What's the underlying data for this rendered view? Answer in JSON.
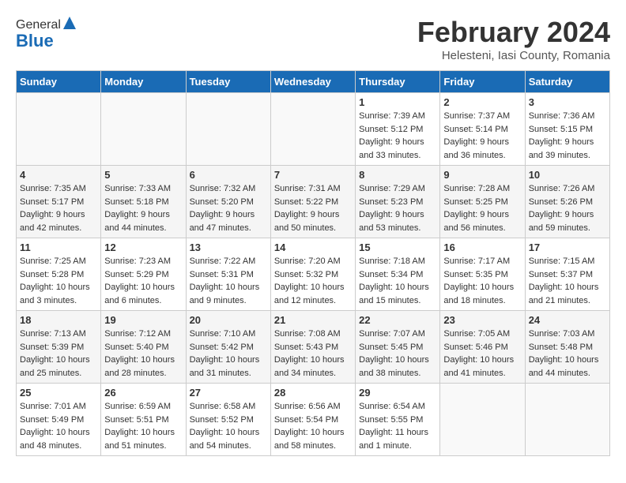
{
  "header": {
    "logo_general": "General",
    "logo_blue": "Blue",
    "month_year": "February 2024",
    "location": "Helesteni, Iasi County, Romania"
  },
  "weekdays": [
    "Sunday",
    "Monday",
    "Tuesday",
    "Wednesday",
    "Thursday",
    "Friday",
    "Saturday"
  ],
  "weeks": [
    [
      {
        "day": "",
        "empty": true
      },
      {
        "day": "",
        "empty": true
      },
      {
        "day": "",
        "empty": true
      },
      {
        "day": "",
        "empty": true
      },
      {
        "day": "1",
        "sunrise": "7:39 AM",
        "sunset": "5:12 PM",
        "daylight": "9 hours and 33 minutes."
      },
      {
        "day": "2",
        "sunrise": "7:37 AM",
        "sunset": "5:14 PM",
        "daylight": "9 hours and 36 minutes."
      },
      {
        "day": "3",
        "sunrise": "7:36 AM",
        "sunset": "5:15 PM",
        "daylight": "9 hours and 39 minutes."
      }
    ],
    [
      {
        "day": "4",
        "sunrise": "7:35 AM",
        "sunset": "5:17 PM",
        "daylight": "9 hours and 42 minutes."
      },
      {
        "day": "5",
        "sunrise": "7:33 AM",
        "sunset": "5:18 PM",
        "daylight": "9 hours and 44 minutes."
      },
      {
        "day": "6",
        "sunrise": "7:32 AM",
        "sunset": "5:20 PM",
        "daylight": "9 hours and 47 minutes."
      },
      {
        "day": "7",
        "sunrise": "7:31 AM",
        "sunset": "5:22 PM",
        "daylight": "9 hours and 50 minutes."
      },
      {
        "day": "8",
        "sunrise": "7:29 AM",
        "sunset": "5:23 PM",
        "daylight": "9 hours and 53 minutes."
      },
      {
        "day": "9",
        "sunrise": "7:28 AM",
        "sunset": "5:25 PM",
        "daylight": "9 hours and 56 minutes."
      },
      {
        "day": "10",
        "sunrise": "7:26 AM",
        "sunset": "5:26 PM",
        "daylight": "9 hours and 59 minutes."
      }
    ],
    [
      {
        "day": "11",
        "sunrise": "7:25 AM",
        "sunset": "5:28 PM",
        "daylight": "10 hours and 3 minutes."
      },
      {
        "day": "12",
        "sunrise": "7:23 AM",
        "sunset": "5:29 PM",
        "daylight": "10 hours and 6 minutes."
      },
      {
        "day": "13",
        "sunrise": "7:22 AM",
        "sunset": "5:31 PM",
        "daylight": "10 hours and 9 minutes."
      },
      {
        "day": "14",
        "sunrise": "7:20 AM",
        "sunset": "5:32 PM",
        "daylight": "10 hours and 12 minutes."
      },
      {
        "day": "15",
        "sunrise": "7:18 AM",
        "sunset": "5:34 PM",
        "daylight": "10 hours and 15 minutes."
      },
      {
        "day": "16",
        "sunrise": "7:17 AM",
        "sunset": "5:35 PM",
        "daylight": "10 hours and 18 minutes."
      },
      {
        "day": "17",
        "sunrise": "7:15 AM",
        "sunset": "5:37 PM",
        "daylight": "10 hours and 21 minutes."
      }
    ],
    [
      {
        "day": "18",
        "sunrise": "7:13 AM",
        "sunset": "5:39 PM",
        "daylight": "10 hours and 25 minutes."
      },
      {
        "day": "19",
        "sunrise": "7:12 AM",
        "sunset": "5:40 PM",
        "daylight": "10 hours and 28 minutes."
      },
      {
        "day": "20",
        "sunrise": "7:10 AM",
        "sunset": "5:42 PM",
        "daylight": "10 hours and 31 minutes."
      },
      {
        "day": "21",
        "sunrise": "7:08 AM",
        "sunset": "5:43 PM",
        "daylight": "10 hours and 34 minutes."
      },
      {
        "day": "22",
        "sunrise": "7:07 AM",
        "sunset": "5:45 PM",
        "daylight": "10 hours and 38 minutes."
      },
      {
        "day": "23",
        "sunrise": "7:05 AM",
        "sunset": "5:46 PM",
        "daylight": "10 hours and 41 minutes."
      },
      {
        "day": "24",
        "sunrise": "7:03 AM",
        "sunset": "5:48 PM",
        "daylight": "10 hours and 44 minutes."
      }
    ],
    [
      {
        "day": "25",
        "sunrise": "7:01 AM",
        "sunset": "5:49 PM",
        "daylight": "10 hours and 48 minutes."
      },
      {
        "day": "26",
        "sunrise": "6:59 AM",
        "sunset": "5:51 PM",
        "daylight": "10 hours and 51 minutes."
      },
      {
        "day": "27",
        "sunrise": "6:58 AM",
        "sunset": "5:52 PM",
        "daylight": "10 hours and 54 minutes."
      },
      {
        "day": "28",
        "sunrise": "6:56 AM",
        "sunset": "5:54 PM",
        "daylight": "10 hours and 58 minutes."
      },
      {
        "day": "29",
        "sunrise": "6:54 AM",
        "sunset": "5:55 PM",
        "daylight": "11 hours and 1 minute."
      },
      {
        "day": "",
        "empty": true
      },
      {
        "day": "",
        "empty": true
      }
    ]
  ]
}
